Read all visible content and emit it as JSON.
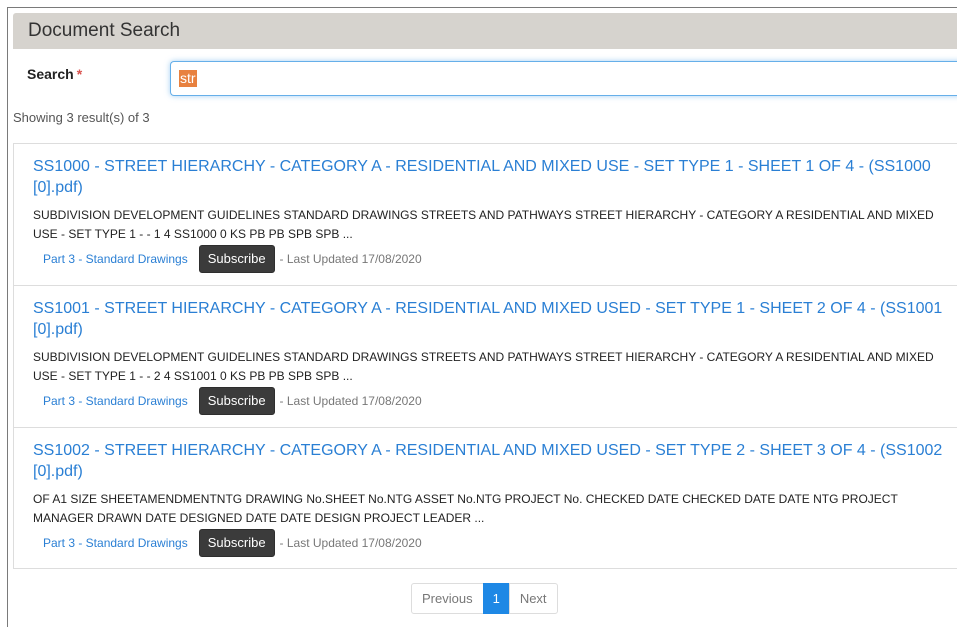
{
  "header": {
    "title": "Document Search"
  },
  "search": {
    "label": "Search",
    "required_mark": "*",
    "value": "str"
  },
  "summary": "Showing 3 result(s) of 3",
  "results": [
    {
      "title": "SS1000 - STREET HIERARCHY - CATEGORY A - RESIDENTIAL AND MIXED USE - SET TYPE 1 - SHEET 1 OF 4 - (SS1000 [0].pdf)",
      "snippet": "SUBDIVISION DEVELOPMENT GUIDELINES STANDARD DRAWINGS STREETS AND PATHWAYS STREET HIERARCHY - CATEGORY A RESIDENTIAL AND MIXED USE - SET TYPE 1 - - 1 4 SS1000 0 KS PB PB SPB SPB ...",
      "category": "Part 3 - Standard Drawings",
      "subscribe_label": "Subscribe",
      "updated": "- Last Updated 17/08/2020"
    },
    {
      "title": "SS1001 - STREET HIERARCHY - CATEGORY A - RESIDENTIAL AND MIXED USED - SET TYPE 1 - SHEET 2 OF 4 - (SS1001 [0].pdf)",
      "snippet": "SUBDIVISION DEVELOPMENT GUIDELINES STANDARD DRAWINGS STREETS AND PATHWAYS STREET HIERARCHY - CATEGORY A RESIDENTIAL AND MIXED USE - SET TYPE 1 - - 2 4 SS1001 0 KS PB PB SPB SPB ...",
      "category": "Part 3 - Standard Drawings",
      "subscribe_label": "Subscribe",
      "updated": "- Last Updated 17/08/2020"
    },
    {
      "title": "SS1002 - STREET HIERARCHY - CATEGORY A - RESIDENTIAL AND MIXED USED - SET TYPE 2 - SHEET 3 OF 4 - (SS1002 [0].pdf)",
      "snippet": "OF A1 SIZE SHEETAMENDMENTNTG DRAWING No.SHEET No.NTG ASSET No.NTG PROJECT No. CHECKED DATE CHECKED DATE DATE NTG PROJECT MANAGER DRAWN DATE DESIGNED DATE DATE DESIGN PROJECT LEADER ...",
      "category": "Part 3 - Standard Drawings",
      "subscribe_label": "Subscribe",
      "updated": "- Last Updated 17/08/2020"
    }
  ],
  "pagination": {
    "previous": "Previous",
    "current": "1",
    "next": "Next"
  },
  "colors": {
    "header_bg": "#d6d3ce",
    "link": "#2a7fd4",
    "button_bg": "#3b3b3b",
    "active_page": "#1e88e5",
    "required": "#d9534f",
    "highlight": "#e8813f"
  }
}
